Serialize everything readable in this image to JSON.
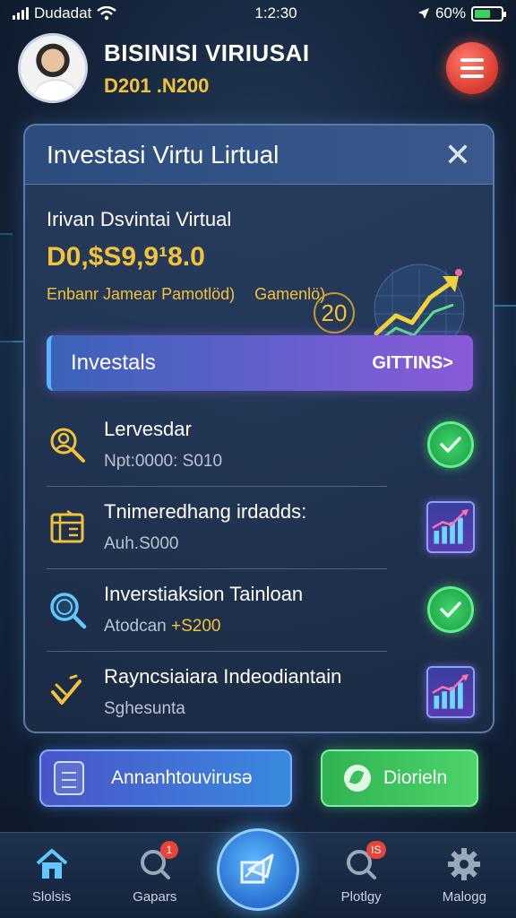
{
  "status_bar": {
    "carrier": "Dudadat",
    "time": "1:2:30",
    "battery_percent_label": "60%",
    "battery_level": 0.6
  },
  "header": {
    "title": "BISINISI VIRIUSAI",
    "subtitle": "D201 .N200",
    "avatar_icon": "user-avatar",
    "menu_icon": "hamburger-menu-icon"
  },
  "card": {
    "title": "Investasi Virtu Lirtual",
    "close_icon": "close-icon",
    "summary": {
      "label": "Irivan Dsvintai Virtual",
      "value": "D0,$S9,9¹8.0",
      "desc_left": "Enbanr Jamear Pamotlöd)",
      "desc_right": "Gamenlö)",
      "count": "20"
    },
    "cta": {
      "label": "Investals",
      "action": "GITTINS>"
    },
    "items": [
      {
        "title": "Lervesdar",
        "sub": "Npt:0000: S010",
        "sub_highlight": "",
        "icon": "search-person-icon",
        "status": "check"
      },
      {
        "title": "Tnimeredhang irdadds:",
        "sub": "Auh.S000",
        "sub_highlight": "",
        "icon": "document-grid-icon",
        "status": "chart"
      },
      {
        "title": "Inverstiaksion Tainloan",
        "sub": "Atodcan ",
        "sub_highlight": "+S200",
        "icon": "magnifier-icon",
        "status": "check"
      },
      {
        "title": "Rayncsiaiara Indeodiantain",
        "sub": "Sghesunta",
        "sub_highlight": "",
        "icon": "check-arrow-icon",
        "status": "chart"
      }
    ]
  },
  "buttons": {
    "primary_label": "Annanhtouvirusə",
    "secondary_label": "Diorieln"
  },
  "tabs": [
    {
      "label": "Slolsis",
      "icon": "home-icon",
      "badge": ""
    },
    {
      "label": "Gapars",
      "icon": "search-icon",
      "badge": "1"
    },
    {
      "label": "",
      "icon": "wallet-send-icon",
      "badge": ""
    },
    {
      "label": "Plotlgy",
      "icon": "search-alert-icon",
      "badge": "IS"
    },
    {
      "label": "Malogg",
      "icon": "gear-icon",
      "badge": ""
    }
  ],
  "colors": {
    "accent_gold": "#f2c23a",
    "success_green": "#3cd66a",
    "danger_red": "#d83a2e",
    "primary_blue": "#3a8ae0"
  }
}
